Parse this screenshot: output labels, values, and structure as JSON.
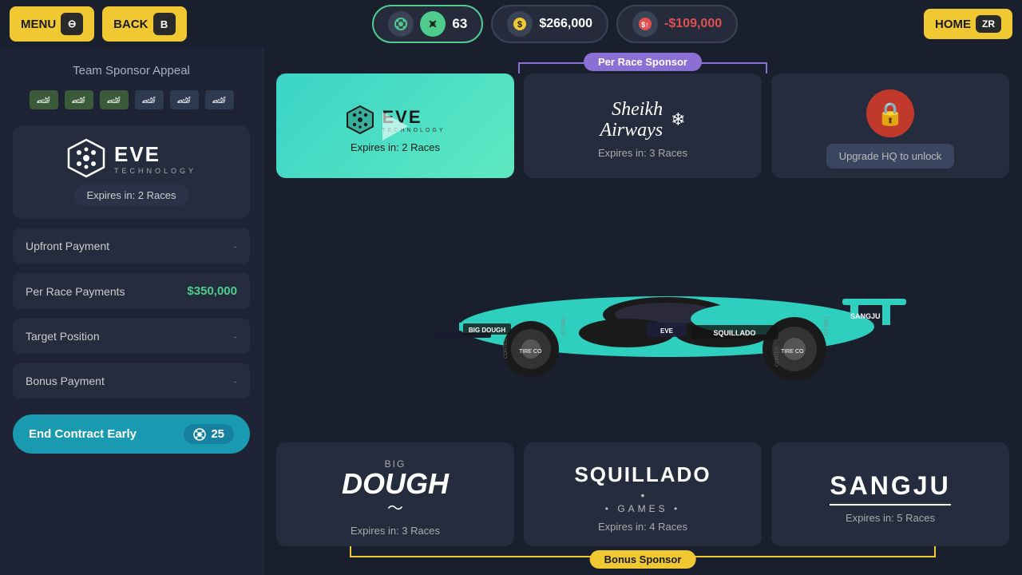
{
  "topbar": {
    "menu_label": "MENU",
    "menu_badge": "⊖",
    "back_label": "BACK",
    "back_badge": "B",
    "home_label": "HOME",
    "home_badge": "ZR",
    "stat_tokens": "63",
    "stat_money": "$266,000",
    "stat_expense": "-$109,000"
  },
  "leftpanel": {
    "title": "Team Sponsor Appeal",
    "sponsor_name_big": "EVE",
    "sponsor_sub": "TECHNOLOGY",
    "expires_label": "Expires in: 2 Races",
    "upfront_label": "Upfront Payment",
    "upfront_value": "-",
    "per_race_label": "Per Race Payments",
    "per_race_value": "$350,000",
    "target_label": "Target Position",
    "target_value": "-",
    "bonus_label": "Bonus Payment",
    "bonus_value": "-",
    "end_contract_label": "End Contract Early",
    "end_contract_cost": "25"
  },
  "per_race_label": "Per Race Sponsor",
  "bonus_label": "Bonus Sponsor",
  "cards_top": [
    {
      "brand": "EVE",
      "type": "eve_active",
      "expires": "Expires in: 2 Races"
    },
    {
      "brand": "Sheikh Airways",
      "type": "sheikh",
      "expires": "Expires in: 3 Races"
    },
    {
      "brand": "Locked",
      "type": "locked",
      "upgrade_text": "Upgrade HQ to unlock"
    }
  ],
  "cards_bottom": [
    {
      "brand": "Big Dough",
      "type": "bigdough",
      "expires": "Expires in: 3 Races"
    },
    {
      "brand": "Squillado Games",
      "type": "squillado",
      "expires": "Expires in: 4 Races"
    },
    {
      "brand": "Sangju",
      "type": "sangju",
      "expires": "Expires in: 5 Races"
    }
  ]
}
